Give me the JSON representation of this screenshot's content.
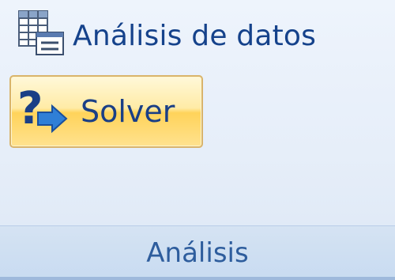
{
  "group": {
    "title": "Análisis",
    "items": [
      {
        "label": "Análisis de datos",
        "icon": "data-analysis-icon"
      },
      {
        "label": "Solver",
        "icon": "solver-icon",
        "state": "hover"
      }
    ]
  },
  "colors": {
    "text": "#15428b",
    "hover_fill": "#ffd35a",
    "hover_border": "#d9b46b",
    "footer_bg": "#c8dbf1"
  }
}
